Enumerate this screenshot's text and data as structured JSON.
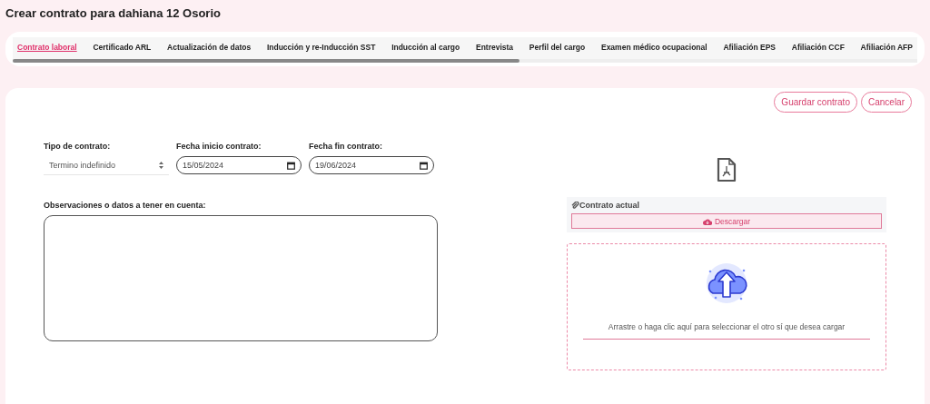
{
  "page_title": "Crear contrato para dahiana 12 Osorio",
  "tabs": [
    {
      "label": "Contrato laboral",
      "selected": true
    },
    {
      "label": "Certificado ARL",
      "selected": false
    },
    {
      "label": "Actualización de datos",
      "selected": false
    },
    {
      "label": "Inducción y re-Inducción SST",
      "selected": false
    },
    {
      "label": "Inducción al cargo",
      "selected": false
    },
    {
      "label": "Entrevista",
      "selected": false
    },
    {
      "label": "Perfil del cargo",
      "selected": false
    },
    {
      "label": "Examen médico ocupacional",
      "selected": false
    },
    {
      "label": "Afiliación EPS",
      "selected": false
    },
    {
      "label": "Afiliación CCF",
      "selected": false
    },
    {
      "label": "Afiliación AFP",
      "selected": false
    }
  ],
  "actions": [
    "Guardar contrato",
    "Cancelar"
  ],
  "form": {
    "contract_type": {
      "label": "Tipo de contrato:",
      "value": "Termino indefinido"
    },
    "start_date": {
      "label": "Fecha inicio contrato:",
      "value": "15/05/2024"
    },
    "end_date": {
      "label": "Fecha fin contrato:",
      "value": "19/06/2024"
    },
    "notes": {
      "label": "Observaciones o datos a tener en cuenta:"
    }
  },
  "current_contract": {
    "title": "Contrato actual",
    "download_button": "Descargar"
  },
  "dropzone": {
    "text": "Arrastre o haga clic aquí para seleccionar el otro sí que desea cargar"
  }
}
